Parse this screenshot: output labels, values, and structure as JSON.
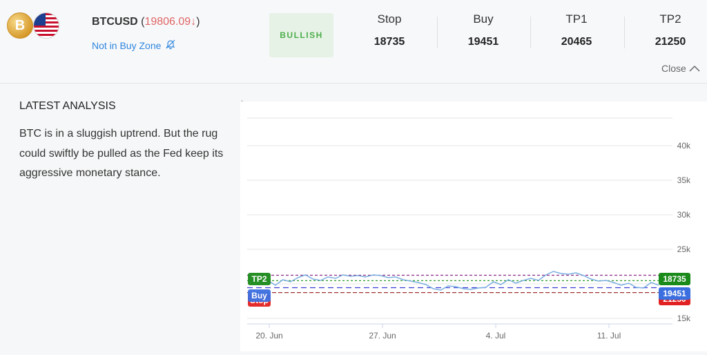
{
  "header": {
    "symbol": "BTCUSD",
    "price_text": "19806.09↓",
    "paren_open": "(",
    "paren_close": ")",
    "zone_label": "Not in Buy Zone",
    "sentiment": "BULLISH",
    "close_label": "Close",
    "coin_symbol": "B",
    "levels": [
      {
        "label": "Stop",
        "value": "18735"
      },
      {
        "label": "Buy",
        "value": "19451"
      },
      {
        "label": "TP1",
        "value": "20465"
      },
      {
        "label": "TP2",
        "value": "21250"
      }
    ]
  },
  "analysis": {
    "title": "LATEST ANALYSIS",
    "text": "BTC is in a sluggish uptrend. But the rug could swiftly be pulled as the Fed keep its aggressive monetary stance."
  },
  "colors": {
    "price_down": "#e06666",
    "link": "#2e86de",
    "bullish_text": "#4cae4c",
    "tp2": "#1a8a1a",
    "buy": "#3b6fe0",
    "stop": "#e22222",
    "line": "#7aaee0"
  },
  "chart_data": {
    "type": "line",
    "x_ticks": [
      "20. Jun",
      "27. Jun",
      "4. Jul",
      "11. Jul"
    ],
    "y_ticks": [
      "15k",
      "25k",
      "30k",
      "35k",
      "40k"
    ],
    "ylim": [
      15000,
      44000
    ],
    "markers": [
      {
        "name": "TP2",
        "value": 21250
      },
      {
        "name": "TP1",
        "value": 20465
      },
      {
        "name": "Buy",
        "value": 19451
      },
      {
        "name": "Stop",
        "value": 18735
      }
    ],
    "right_labels": [
      "21250",
      "19451",
      "18735"
    ],
    "series": [
      {
        "values": [
          20500,
          19800,
          20600,
          20300,
          20900,
          21300,
          20700,
          20500,
          21000,
          20800,
          21300,
          21100,
          21200,
          21000,
          21300,
          21200,
          20900,
          21000,
          20600,
          20400,
          20200,
          19900,
          19300,
          19100,
          19700,
          19600,
          19300,
          19200,
          19400,
          19500,
          20300,
          19900,
          20600,
          20100,
          20500,
          20800,
          20500,
          21300,
          21800,
          21500,
          21400,
          21600,
          21200,
          20700,
          20400,
          20500,
          20200,
          19800,
          20100,
          19500,
          19400,
          20200,
          19806
        ]
      }
    ]
  }
}
